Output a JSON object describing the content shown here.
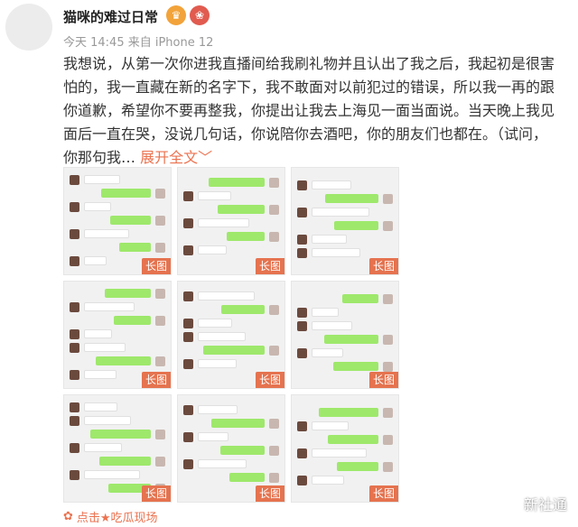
{
  "post": {
    "username": "猫咪的难过日常",
    "badges": [
      {
        "icon": "vip-crown-icon",
        "glyph": "♛"
      },
      {
        "icon": "ribbon-icon",
        "glyph": "❀"
      }
    ],
    "meta": "今天 14:45 来自 iPhone 12",
    "body": "我想说，从第一次你进我直播间给我刷礼物并且认出了我之后，我起初是很害怕的，我一直藏在新的名字下，我不敢面对以前犯过的错误，所以我一再的跟你道歉，希望你不要再整我，你提出让我去上海见一面当面说。当天晚上我见面后一直在哭，没说几句话，你说陪你去酒吧，你的朋友们也都在。（试问，你那句我…",
    "expand_label": "展开全文",
    "expand_chevron": "﹀"
  },
  "images": [
    {
      "tag": "长图"
    },
    {
      "tag": "长图"
    },
    {
      "tag": "长图"
    },
    {
      "tag": "长图"
    },
    {
      "tag": "长图"
    },
    {
      "tag": "长图"
    },
    {
      "tag": "长图"
    },
    {
      "tag": "长图"
    },
    {
      "tag": "长图"
    }
  ],
  "footer": {
    "icon": "flower-icon",
    "glyph": "✿",
    "text": "点击★吃瓜现场"
  },
  "watermark": "新社通",
  "colors": {
    "accent": "#eb7350",
    "bubble_green": "#9ee86b",
    "tag_bg": "#e5734f"
  }
}
